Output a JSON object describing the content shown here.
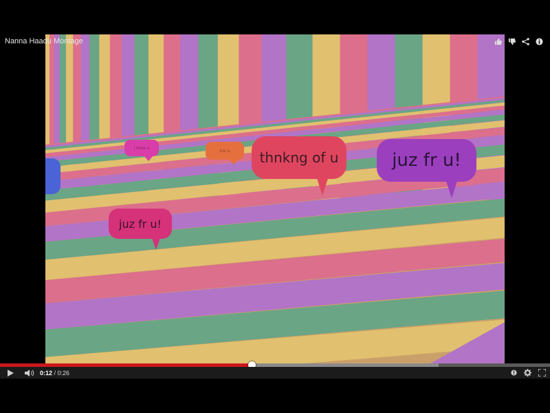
{
  "player": {
    "title": "Nanna Haadu Montage",
    "actions": [
      "like-icon",
      "dislike-icon",
      "share-icon",
      "info-icon"
    ]
  },
  "video": {
    "bubbles": {
      "small_pink": "i miss u",
      "small_orange": "luv u",
      "thinking": "thnkng of u",
      "purple": "juz fr u!",
      "pink": "juz fr u!"
    },
    "stripe_colors": [
      "#e1c06f",
      "#dc6f8c",
      "#b274c6",
      "#6aa585"
    ]
  },
  "controls": {
    "current_time": "0:12",
    "separator": " / ",
    "duration": "0:26",
    "progress_played": 0.458,
    "progress_buffered": 0.798,
    "icons": [
      "play-icon",
      "volume-icon",
      "annotations-icon",
      "settings-icon",
      "fullscreen-icon"
    ],
    "accent": "#cc181e"
  }
}
